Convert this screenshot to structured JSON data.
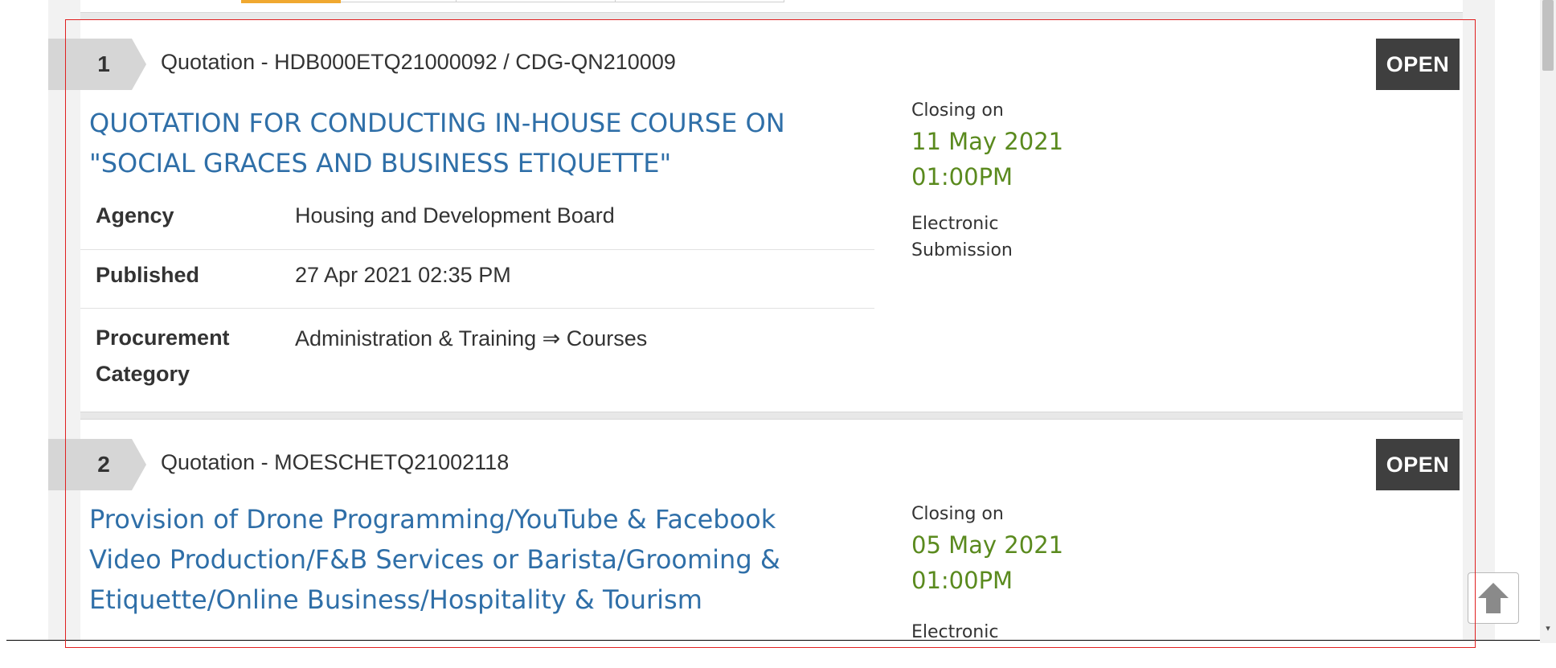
{
  "tenders": [
    {
      "index": "1",
      "reference": "Quotation - HDB000ETQ21000092 / CDG-QN210009",
      "status": "OPEN",
      "title_line1": "QUOTATION FOR CONDUCTING IN-HOUSE COURSE ON",
      "title_line2": "\"SOCIAL GRACES AND BUSINESS ETIQUETTE\"",
      "details": {
        "agency_label": "Agency",
        "agency_value": "Housing and Development Board",
        "published_label": "Published",
        "published_value": "27 Apr 2021 02:35 PM",
        "category_label_line1": "Procurement",
        "category_label_line2": "Category",
        "category_value": "Administration & Training ⇒ Courses"
      },
      "closing_label": "Closing on",
      "closing_date": "11 May 2021",
      "closing_time": "01:00PM",
      "submission_line1": "Electronic",
      "submission_line2": "Submission"
    },
    {
      "index": "2",
      "reference": "Quotation - MOESCHETQ21002118",
      "status": "OPEN",
      "title_line1": "Provision of Drone Programming/YouTube & Facebook",
      "title_line2": "Video Production/F&B Services or Barista/Grooming &",
      "title_line3": "Etiquette/Online Business/Hospitality & Tourism",
      "closing_label": "Closing on",
      "closing_date": "05 May 2021",
      "closing_time": "01:00PM",
      "submission_line1": "Electronic"
    }
  ],
  "colors": {
    "link": "#2f6fa8",
    "closing": "#5a8a1e",
    "badge_bg": "#3f3f3f",
    "highlight": "#e02020",
    "active_tab": "#f0a830"
  },
  "icons": {
    "back_to_top": "arrow-up-icon",
    "scroll_down": "scroll-down-arrow-icon"
  }
}
